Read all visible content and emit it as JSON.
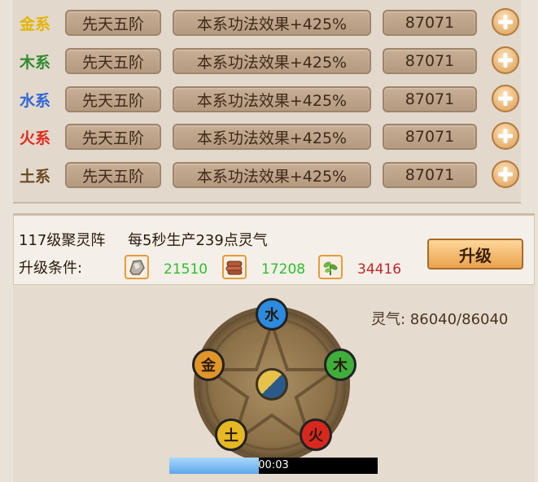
{
  "elements": [
    {
      "name": "金系",
      "color": "#e3b400",
      "level": "先天五阶",
      "effect": "本系功法效果+425%",
      "value": "87071"
    },
    {
      "name": "木系",
      "color": "#2f8a2f",
      "level": "先天五阶",
      "effect": "本系功法效果+425%",
      "value": "87071"
    },
    {
      "name": "水系",
      "color": "#3066d6",
      "level": "先天五阶",
      "effect": "本系功法效果+425%",
      "value": "87071"
    },
    {
      "name": "火系",
      "color": "#e02a1f",
      "level": "先天五阶",
      "effect": "本系功法效果+425%",
      "value": "87071"
    },
    {
      "name": "土系",
      "color": "#6a4a22",
      "level": "先天五阶",
      "effect": "本系功法效果+425%",
      "value": "87071"
    }
  ],
  "array": {
    "title": "117级聚灵阵",
    "description": "每5秒生产239点灵气",
    "condition_label": "升级条件:",
    "upgrade_label": "升级",
    "resources": [
      {
        "icon": "stone-ore-icon",
        "count": "21510",
        "color": "#2cbf2c"
      },
      {
        "icon": "wood-logs-icon",
        "count": "17208",
        "color": "#2cbf2c"
      },
      {
        "icon": "herb-plant-icon",
        "count": "34416",
        "color": "#c0272d"
      }
    ]
  },
  "qi": {
    "text": "灵气: 86040/86040"
  },
  "wheel": {
    "orbs": [
      {
        "label": "水",
        "color": "#2c8be0"
      },
      {
        "label": "木",
        "color": "#3fae3a"
      },
      {
        "label": "火",
        "color": "#d8281e"
      },
      {
        "label": "土",
        "color": "#e6b822"
      },
      {
        "label": "金",
        "color": "#e0942a"
      }
    ]
  },
  "progress": {
    "time": "00:03",
    "fraction": 0.43
  }
}
